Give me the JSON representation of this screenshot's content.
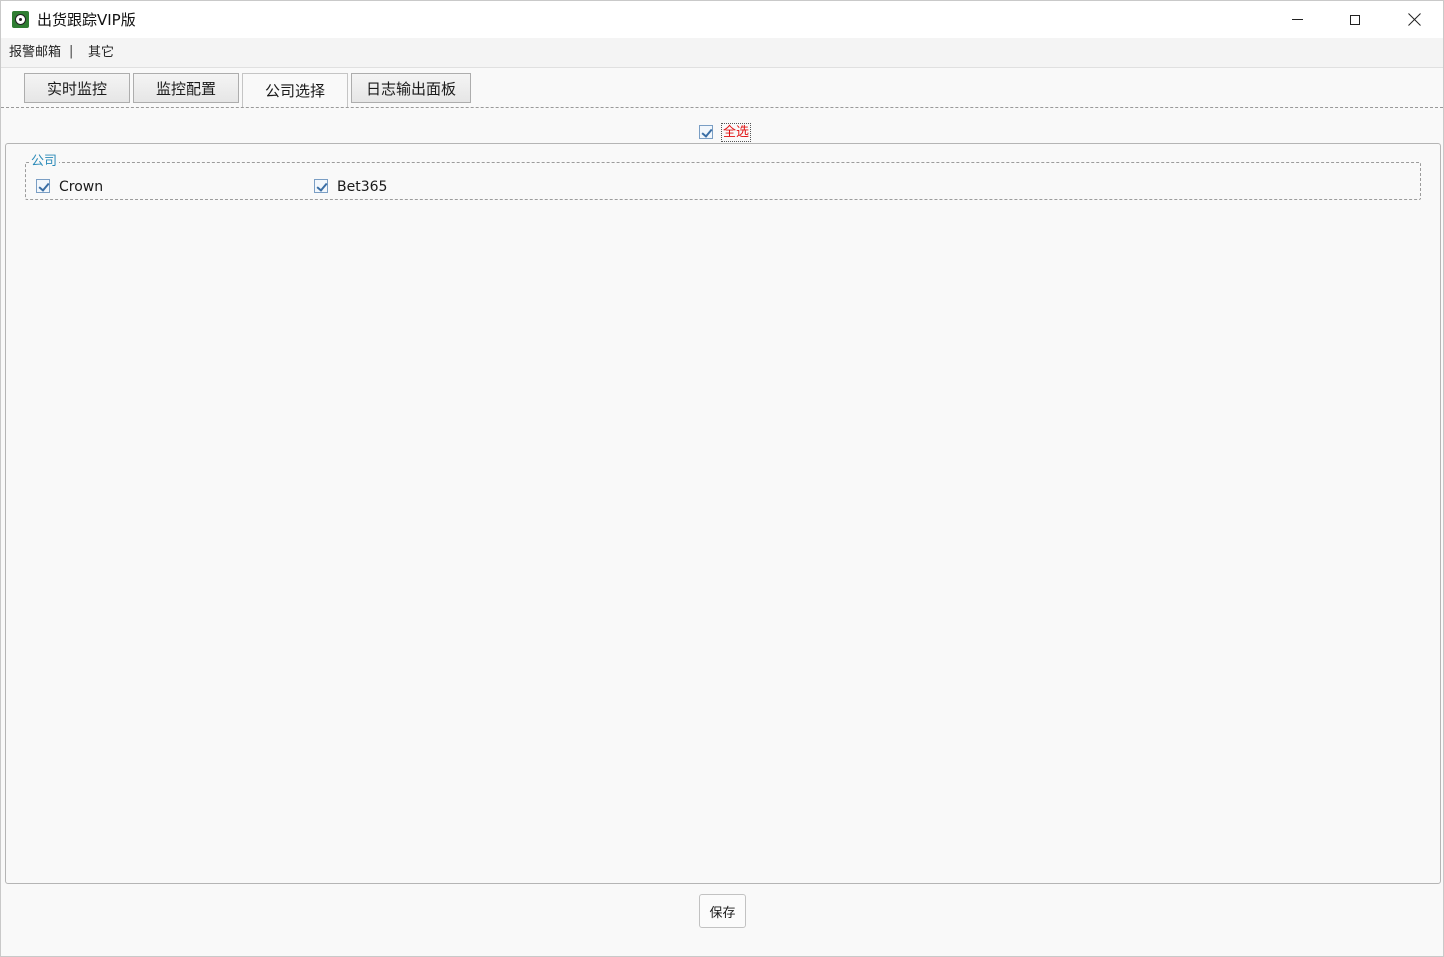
{
  "window": {
    "title": "出货跟踪VIP版"
  },
  "menubar": {
    "items": [
      {
        "label": "报警邮箱"
      },
      {
        "label": "其它"
      }
    ],
    "separator": "|"
  },
  "tabs": [
    {
      "label": "实时监控",
      "active": false
    },
    {
      "label": "监控配置",
      "active": false
    },
    {
      "label": "公司选择",
      "active": true
    },
    {
      "label": "日志输出面板",
      "active": false
    }
  ],
  "select_all": {
    "label": "全选",
    "checked": true,
    "color": "#e01010"
  },
  "company_group": {
    "title": "公司",
    "options": [
      {
        "label": "Crown",
        "checked": true
      },
      {
        "label": "Bet365",
        "checked": true
      }
    ]
  },
  "footer": {
    "save_label": "保存"
  },
  "icons": {
    "app": "soccer-ball-icon",
    "minimize": "minimize-icon",
    "maximize": "maximize-icon",
    "close": "close-icon"
  }
}
